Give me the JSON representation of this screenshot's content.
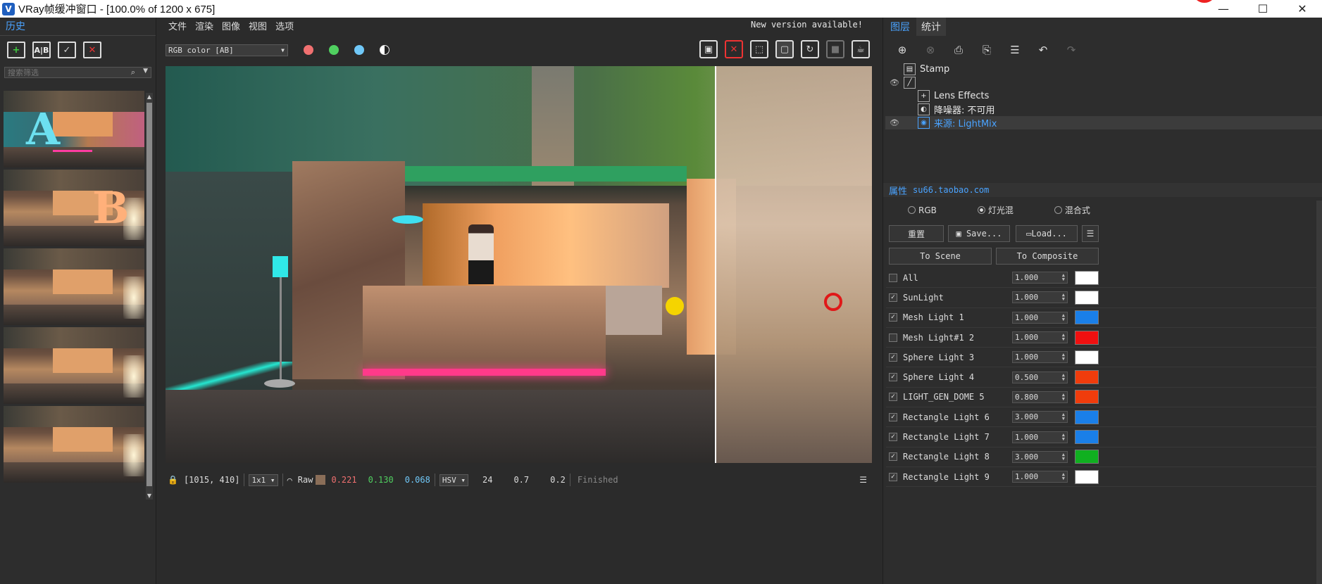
{
  "window": {
    "title": "VRay帧缓冲窗口 - [100.0% of 1200 x 675]"
  },
  "history": {
    "tab": "历史",
    "search_placeholder": "搜索筛选",
    "thumb_letters": {
      "a": "A",
      "b": "B"
    }
  },
  "menu": {
    "file": "文件",
    "render": "渲染",
    "image": "图像",
    "view": "视图",
    "options": "选项"
  },
  "notice": "New version available!",
  "viewer": {
    "channel": "RGB color [AB]"
  },
  "status": {
    "coords": "[1015, 410]",
    "sample": "1x1",
    "mode": "Raw",
    "r": "0.221",
    "g": "0.130",
    "b": "0.068",
    "space": "HSV",
    "h": "24",
    "s": "0.7",
    "v": "0.2",
    "state": "Finished"
  },
  "right": {
    "tabs": [
      "图层",
      "统计"
    ],
    "layers": [
      {
        "label": "Stamp",
        "eye": false,
        "indent": 1,
        "icon": "stamp-icon"
      },
      {
        "label": "",
        "eye": true,
        "indent": 1,
        "icon": "curve-icon"
      },
      {
        "label": "Lens Effects",
        "eye": false,
        "indent": 2,
        "icon": "plus-icon"
      },
      {
        "label": "降噪器: 不可用",
        "eye": false,
        "indent": 2,
        "icon": "denoise-icon"
      },
      {
        "label": "来源: LightMix",
        "eye": true,
        "indent": 2,
        "icon": "bulb-icon",
        "selected": true
      }
    ],
    "props_title": "属性",
    "props_subtitle": "su66.taobao.com",
    "modes": [
      "RGB",
      "灯光混",
      "混合式"
    ],
    "mode_selected": 1,
    "buttons": {
      "reset": "重置",
      "save": "Save...",
      "load": "Load...",
      "to_scene": "To Scene",
      "to_composite": "To Composite"
    },
    "lights": [
      {
        "name": "All",
        "checked": false,
        "value": "1.000",
        "color": "#ffffff"
      },
      {
        "name": "SunLight",
        "checked": true,
        "value": "1.000",
        "color": "#ffffff"
      },
      {
        "name": "Mesh Light 1",
        "checked": true,
        "value": "1.000",
        "color": "#1a7fe8"
      },
      {
        "name": "Mesh Light#1 2",
        "checked": false,
        "value": "1.000",
        "color": "#f01010"
      },
      {
        "name": "Sphere Light 3",
        "checked": true,
        "value": "1.000",
        "color": "#ffffff"
      },
      {
        "name": "Sphere Light 4",
        "checked": true,
        "value": "0.500",
        "color": "#f03c0c"
      },
      {
        "name": "LIGHT_GEN_DOME 5",
        "checked": true,
        "value": "0.800",
        "color": "#f03c0c"
      },
      {
        "name": "Rectangle Light 6",
        "checked": true,
        "value": "3.000",
        "color": "#1a7fe8"
      },
      {
        "name": "Rectangle Light 7",
        "checked": true,
        "value": "1.000",
        "color": "#1a7fe8"
      },
      {
        "name": "Rectangle Light 8",
        "checked": true,
        "value": "3.000",
        "color": "#10b020"
      },
      {
        "name": "Rectangle Light 9",
        "checked": true,
        "value": "1.000",
        "color": "#ffffff"
      }
    ]
  },
  "colors": {
    "accent": "#4aa3ff",
    "red_dot": "#f07070",
    "green_dot": "#50d060",
    "blue_dot": "#70c8f8"
  }
}
